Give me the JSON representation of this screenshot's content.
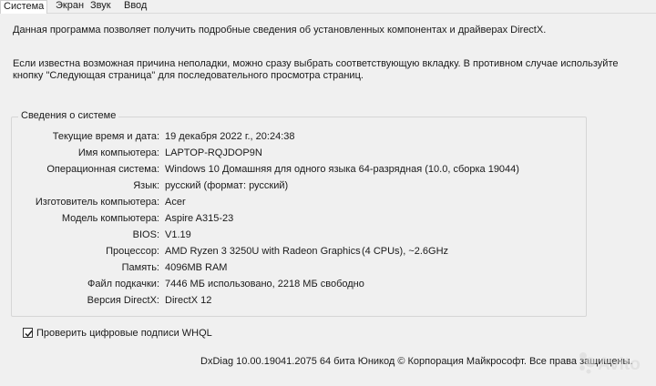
{
  "tabs": [
    {
      "label": "Система",
      "active": true
    },
    {
      "label": "Экран",
      "active": false
    },
    {
      "label": "Звук",
      "active": false
    },
    {
      "label": "Ввод",
      "active": false
    }
  ],
  "intro": {
    "line1": "Данная программа позволяет получить подробные сведения об установленных компонентах и драйверах DirectX.",
    "line2": "Если известна возможная причина неполадки, можно сразу выбрать соответствующую вкладку. В противном случае используйте",
    "line3": "кнопку \"Следующая страница\" для последовательного просмотра страниц."
  },
  "system_info": {
    "title": "Сведения о системе",
    "rows": [
      {
        "label": "Текущие время и дата:",
        "value": "19 декабря 2022 г., 20:24:38"
      },
      {
        "label": "Имя компьютера:",
        "value": "LAPTOP-RQJDOP9N"
      },
      {
        "label": "Операционная система:",
        "value": "Windows 10 Домашняя для одного языка 64-разрядная (10.0, сборка 19044)"
      },
      {
        "label": "Язык:",
        "value": "русский (формат: русский)"
      },
      {
        "label": "Изготовитель компьютера:",
        "value": "Acer"
      },
      {
        "label": "Модель компьютера:",
        "value": "Aspire A315-23"
      },
      {
        "label": "BIOS:",
        "value": "V1.19"
      },
      {
        "label": "Процессор:",
        "value": "AMD Ryzen 3 3250U with Radeon Graphics"
      },
      {
        "label": "Память:",
        "value": "4096MB RAM"
      },
      {
        "label": "Файл подкачки:",
        "value": "7446 МБ использовано, 2218 МБ свободно"
      },
      {
        "label": "Версия DirectX:",
        "value": "DirectX 12"
      }
    ],
    "cpu_extra": "(4 CPUs), ~2.6GHz"
  },
  "whql": {
    "label": "Проверить цифровые подписи WHQL",
    "checked": true
  },
  "footer": "DxDiag 10.00.19041.2075 64 бита Юникод © Корпорация Майкрософт. Все права защищены.",
  "watermark": "Avito"
}
